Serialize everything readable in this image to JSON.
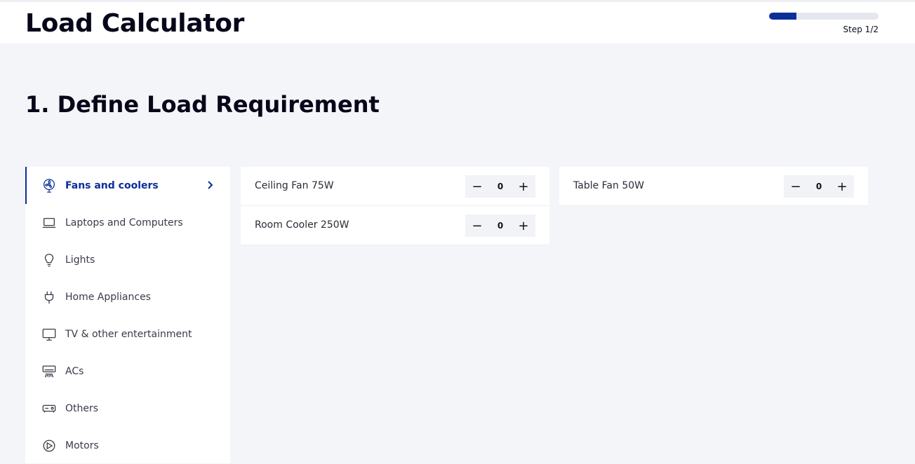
{
  "header": {
    "title": "Load Calculator",
    "step_label": "Step 1/2",
    "progress": 0.25,
    "accent_color": "#0b2f99"
  },
  "section": {
    "title": "1. Define Load Requirement"
  },
  "sidebar": {
    "items": [
      {
        "label": "Fans and coolers",
        "icon": "fan-icon",
        "active": true
      },
      {
        "label": "Laptops and Computers",
        "icon": "laptop-icon",
        "active": false
      },
      {
        "label": "Lights",
        "icon": "bulb-icon",
        "active": false
      },
      {
        "label": "Home Appliances",
        "icon": "plug-icon",
        "active": false
      },
      {
        "label": "TV & other entertainment",
        "icon": "monitor-icon",
        "active": false
      },
      {
        "label": "ACs",
        "icon": "ac-icon",
        "active": false
      },
      {
        "label": "Others",
        "icon": "device-icon",
        "active": false
      },
      {
        "label": "Motors",
        "icon": "motor-icon",
        "active": false
      }
    ]
  },
  "items": {
    "col1": [
      {
        "name": "Ceiling Fan 75W",
        "qty": "0"
      },
      {
        "name": "Room Cooler 250W",
        "qty": "0"
      }
    ],
    "col2": [
      {
        "name": "Table Fan 50W",
        "qty": "0"
      }
    ],
    "minus_symbol": "−",
    "plus_symbol": "+"
  }
}
